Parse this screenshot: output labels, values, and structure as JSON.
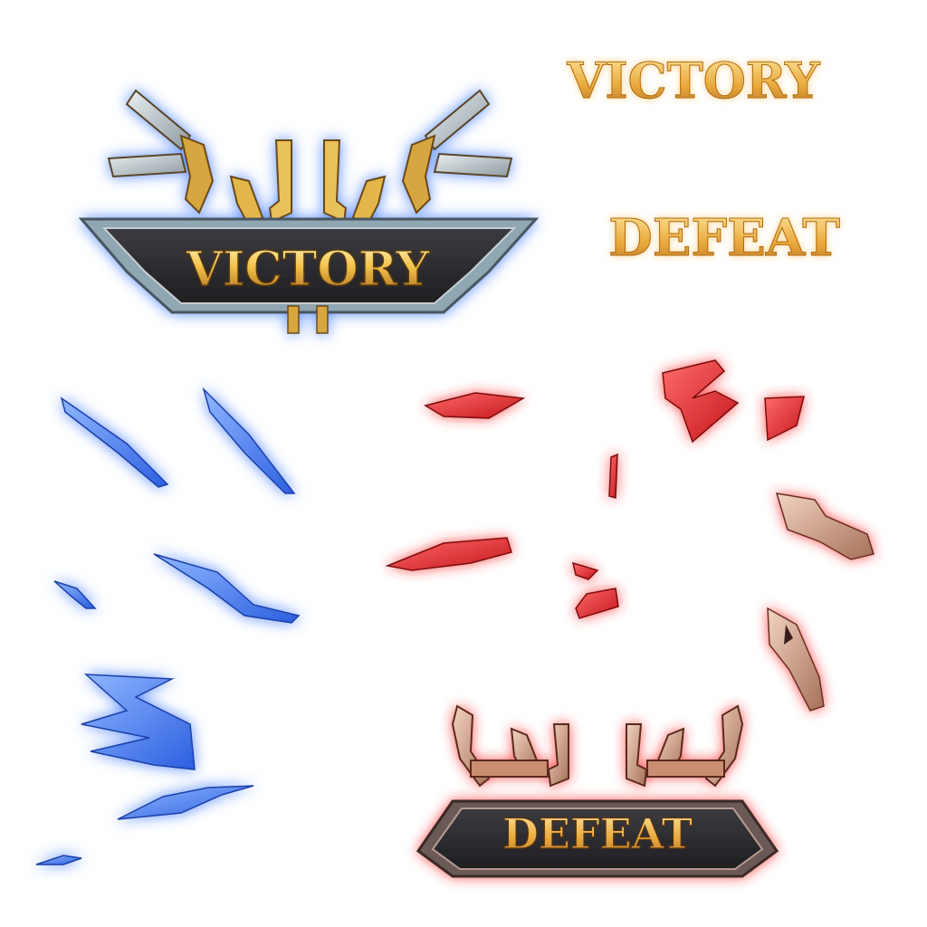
{
  "sprite_sheet": {
    "victory_banner": {
      "text": "VICTORY"
    },
    "defeat_banner": {
      "text": "DEFEAT"
    },
    "victory_title": {
      "text": "VICTORY"
    },
    "defeat_title": {
      "text": "DEFEAT"
    },
    "blue_shards_count": 7,
    "red_shards_count": 10
  },
  "colors": {
    "blue_glow": "#3f7bff",
    "red_glow": "#ff2b2b",
    "gold": "#f2c14e",
    "dark_plate": "#2b2b2f",
    "bronze": "#c89a78"
  }
}
